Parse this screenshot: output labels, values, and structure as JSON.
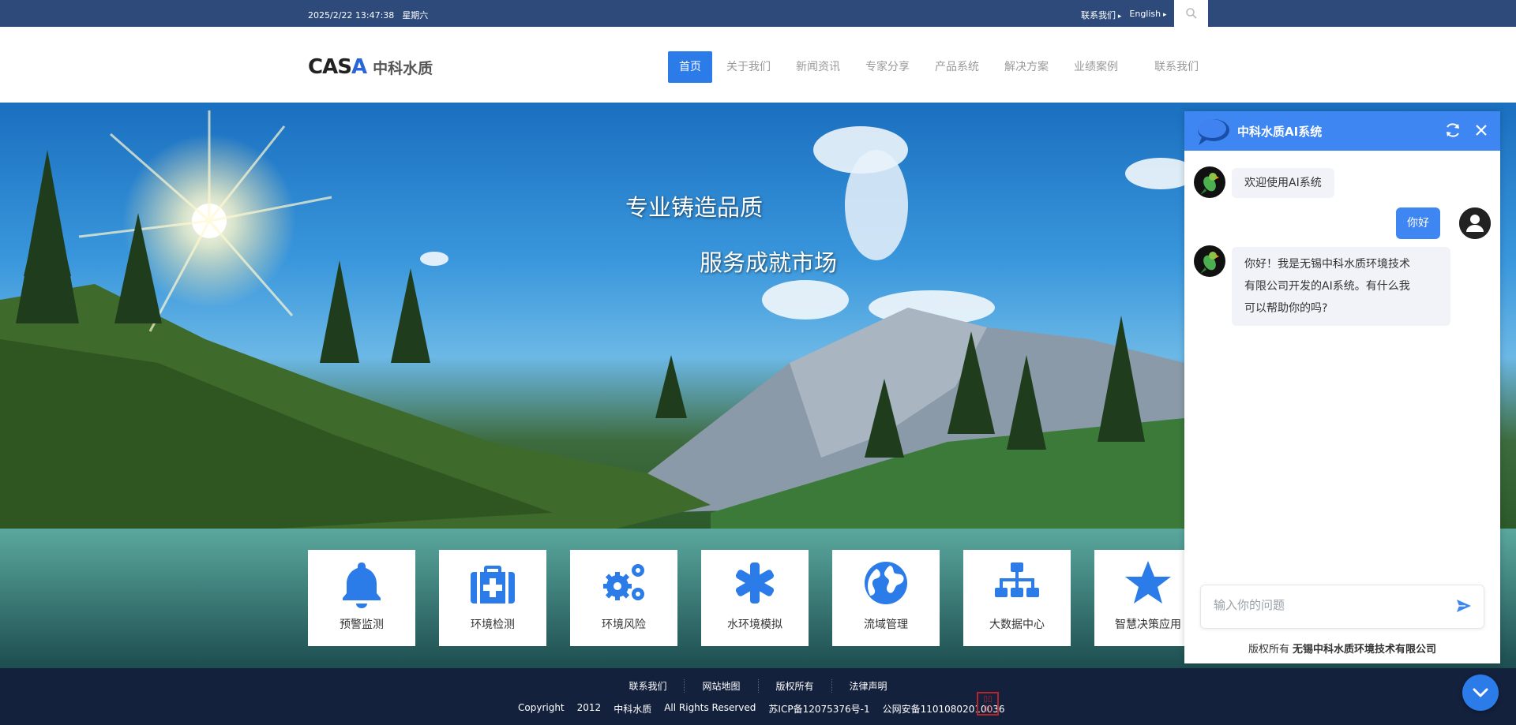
{
  "topbar": {
    "date": "2025/2/22 13:47:38",
    "weekday": "星期六",
    "contact_link": "联系我们",
    "language_link": "English"
  },
  "header": {
    "logo_latin_pre": "CAS",
    "logo_latin_accent": "A",
    "logo_cn": "中科水质",
    "nav": [
      "首页",
      "关于我们",
      "新闻资讯",
      "专家分享",
      "产品系统",
      "解决方案",
      "业绩案例",
      "联系我们"
    ]
  },
  "hero": {
    "slogan_1": "专业铸造品质",
    "slogan_2": "服务成就市场",
    "cards": [
      {
        "label": "预警监测",
        "icon": "bell-icon"
      },
      {
        "label": "环境检测",
        "icon": "medkit-icon"
      },
      {
        "label": "环境风险",
        "icon": "gears-icon"
      },
      {
        "label": "水环境模拟",
        "icon": "asterisk-icon"
      },
      {
        "label": "流域管理",
        "icon": "globe-icon"
      },
      {
        "label": "大数据中心",
        "icon": "sitemap-icon"
      },
      {
        "label": "智慧决策应用",
        "icon": "star-icon"
      }
    ]
  },
  "chat": {
    "title": "中科水质AI系统",
    "messages": [
      {
        "role": "bot",
        "text": "欢迎使用AI系统"
      },
      {
        "role": "user",
        "text": "你好"
      },
      {
        "role": "bot",
        "lines": [
          "你好！我是无锡中科水质环境技术",
          "有限公司开发的AI系统。有什么我",
          "可以帮助你的吗?"
        ]
      }
    ],
    "input_placeholder": "输入你的问题",
    "footer_prefix": "版权所有",
    "footer_company": "无锡中科水质环境技术有限公司"
  },
  "footer": {
    "links": [
      "联系我们",
      "网站地图",
      "版权所有",
      "法律声明"
    ],
    "copyright": "Copyright",
    "year": "2012",
    "brand": "中科水质",
    "rights": "All Rights Reserved",
    "icp": "苏ICP备12075376号-1",
    "police": "公网安备11010802010036"
  },
  "colors": {
    "topbar": "#2e4a7a",
    "accent": "#2b7be9",
    "chat_header": "#3e87f3",
    "footer": "#14213d"
  }
}
